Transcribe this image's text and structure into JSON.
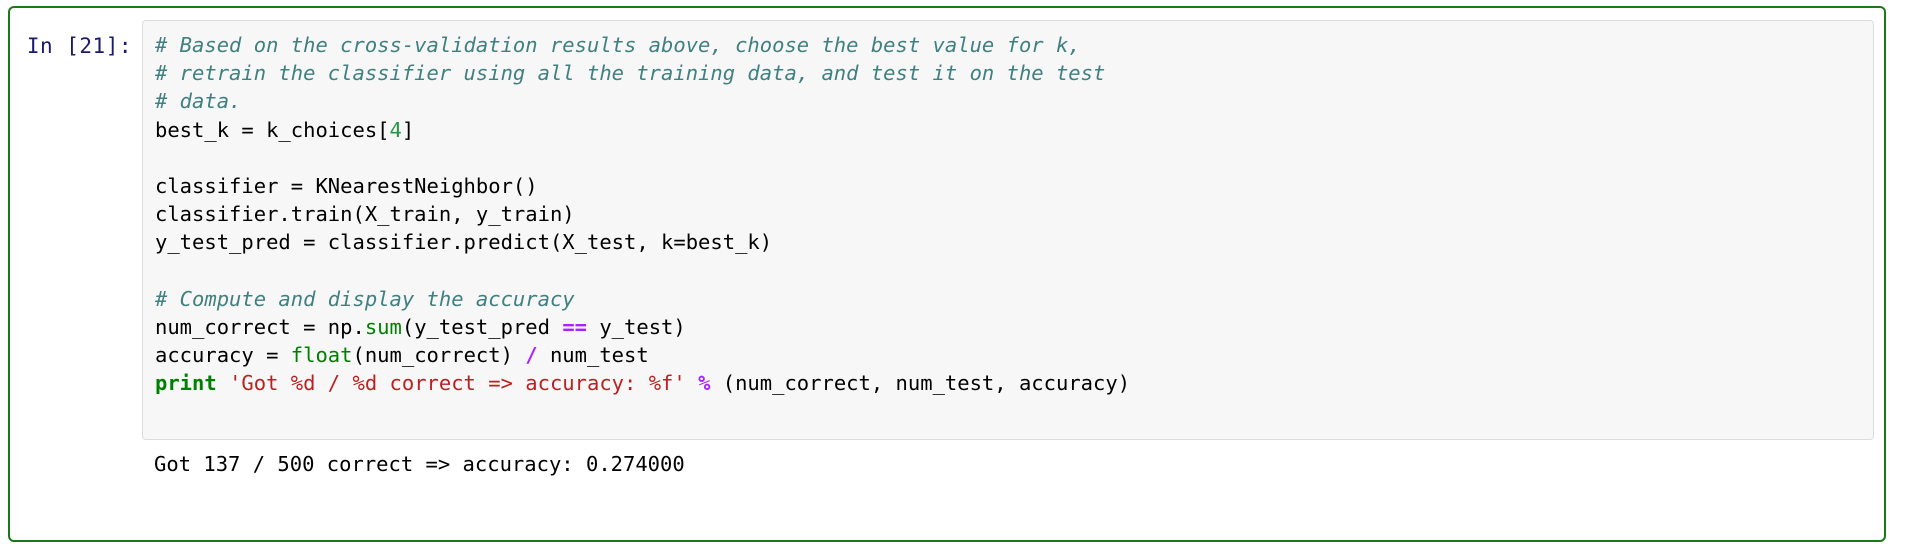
{
  "cell": {
    "prompt": "In [21]:",
    "execution_count": 21,
    "selected_border_color": "#1a7a1a",
    "editor_background": "#f7f7f7",
    "prompt_color": "#1a1a6e"
  },
  "syntax_colors": {
    "comment": "#408080",
    "number": "#229944",
    "builtin": "#008000",
    "keyword": "#008000",
    "string": "#BA2121",
    "operator": "#AA22FF",
    "plain": "#000000"
  },
  "code": {
    "lines": [
      {
        "id": "line-1",
        "tokens": [
          {
            "t": "comment",
            "s": "# Based on the cross-validation results above, choose the best value for k,"
          }
        ]
      },
      {
        "id": "line-2",
        "tokens": [
          {
            "t": "comment",
            "s": "# retrain the classifier using all the training data, and test it on the test"
          }
        ]
      },
      {
        "id": "line-3",
        "tokens": [
          {
            "t": "comment",
            "s": "# data."
          }
        ]
      },
      {
        "id": "line-4",
        "tokens": [
          {
            "t": "plain",
            "s": "best_k = k_choices["
          },
          {
            "t": "number",
            "s": "4"
          },
          {
            "t": "plain",
            "s": "]"
          }
        ]
      },
      {
        "id": "line-5",
        "tokens": []
      },
      {
        "id": "line-6",
        "tokens": [
          {
            "t": "plain",
            "s": "classifier = KNearestNeighbor()"
          }
        ]
      },
      {
        "id": "line-7",
        "tokens": [
          {
            "t": "plain",
            "s": "classifier.train(X_train, y_train)"
          }
        ]
      },
      {
        "id": "line-8",
        "tokens": [
          {
            "t": "plain",
            "s": "y_test_pred = classifier.predict(X_test, k=best_k)"
          }
        ]
      },
      {
        "id": "line-9",
        "tokens": []
      },
      {
        "id": "line-10",
        "tokens": [
          {
            "t": "comment",
            "s": "# Compute and display the accuracy"
          }
        ]
      },
      {
        "id": "line-11",
        "tokens": [
          {
            "t": "plain",
            "s": "num_correct = np."
          },
          {
            "t": "builtin",
            "s": "sum"
          },
          {
            "t": "plain",
            "s": "(y_test_pred "
          },
          {
            "t": "operator",
            "s": "=="
          },
          {
            "t": "plain",
            "s": " y_test)"
          }
        ]
      },
      {
        "id": "line-12",
        "tokens": [
          {
            "t": "plain",
            "s": "accuracy = "
          },
          {
            "t": "builtin",
            "s": "float"
          },
          {
            "t": "plain",
            "s": "(num_correct) "
          },
          {
            "t": "operator",
            "s": "/"
          },
          {
            "t": "plain",
            "s": " num_test"
          }
        ]
      },
      {
        "id": "line-13",
        "tokens": [
          {
            "t": "keyword",
            "s": "print"
          },
          {
            "t": "plain",
            "s": " "
          },
          {
            "t": "string",
            "s": "'Got %d / %d correct => accuracy: %f'"
          },
          {
            "t": "plain",
            "s": " "
          },
          {
            "t": "operator",
            "s": "%"
          },
          {
            "t": "plain",
            "s": " (num_correct, num_test, accuracy)"
          }
        ]
      }
    ]
  },
  "output": {
    "prompt": "",
    "text": "Got 137 / 500 correct => accuracy: 0.274000",
    "num_correct": 137,
    "num_test": 500,
    "accuracy": 0.274
  }
}
